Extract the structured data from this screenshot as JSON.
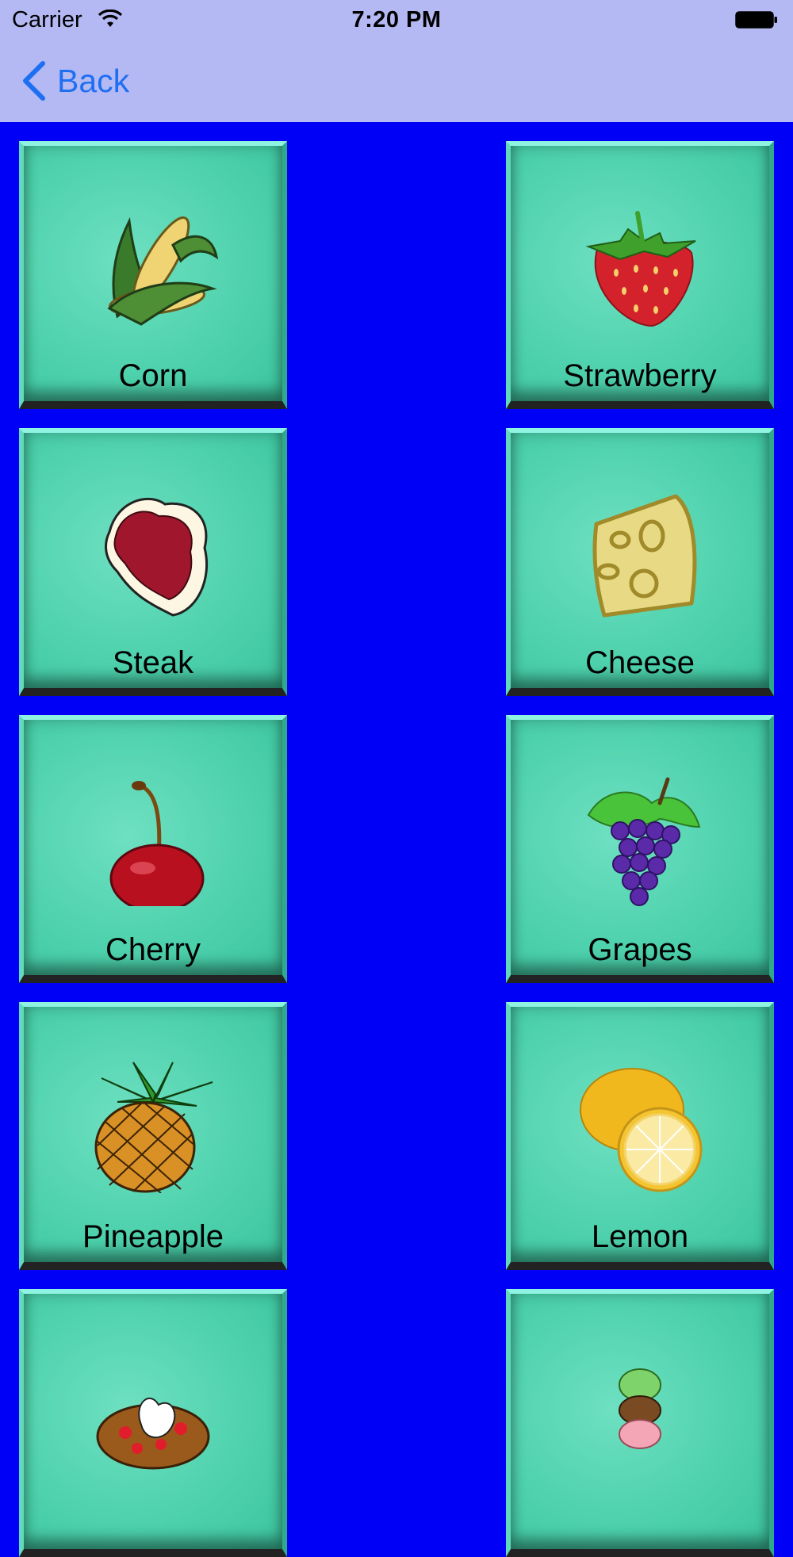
{
  "status_bar": {
    "carrier": "Carrier",
    "time": "7:20 PM"
  },
  "nav": {
    "back_label": "Back",
    "accent_color": "#1f6ff3",
    "bar_color": "#b4b9f3"
  },
  "grid": {
    "background_color": "#0000f7",
    "tiles": [
      {
        "label": "Corn",
        "icon": "corn-icon"
      },
      {
        "label": "Strawberry",
        "icon": "strawberry-icon"
      },
      {
        "label": "Steak",
        "icon": "steak-icon"
      },
      {
        "label": "Cheese",
        "icon": "cheese-icon"
      },
      {
        "label": "Cherry",
        "icon": "cherry-icon"
      },
      {
        "label": "Grapes",
        "icon": "grapes-icon"
      },
      {
        "label": "Pineapple",
        "icon": "pineapple-icon"
      },
      {
        "label": "Lemon",
        "icon": "lemon-icon"
      },
      {
        "label": "",
        "icon": "waffle-icon"
      },
      {
        "label": "",
        "icon": "ice-cream-icon"
      }
    ]
  }
}
